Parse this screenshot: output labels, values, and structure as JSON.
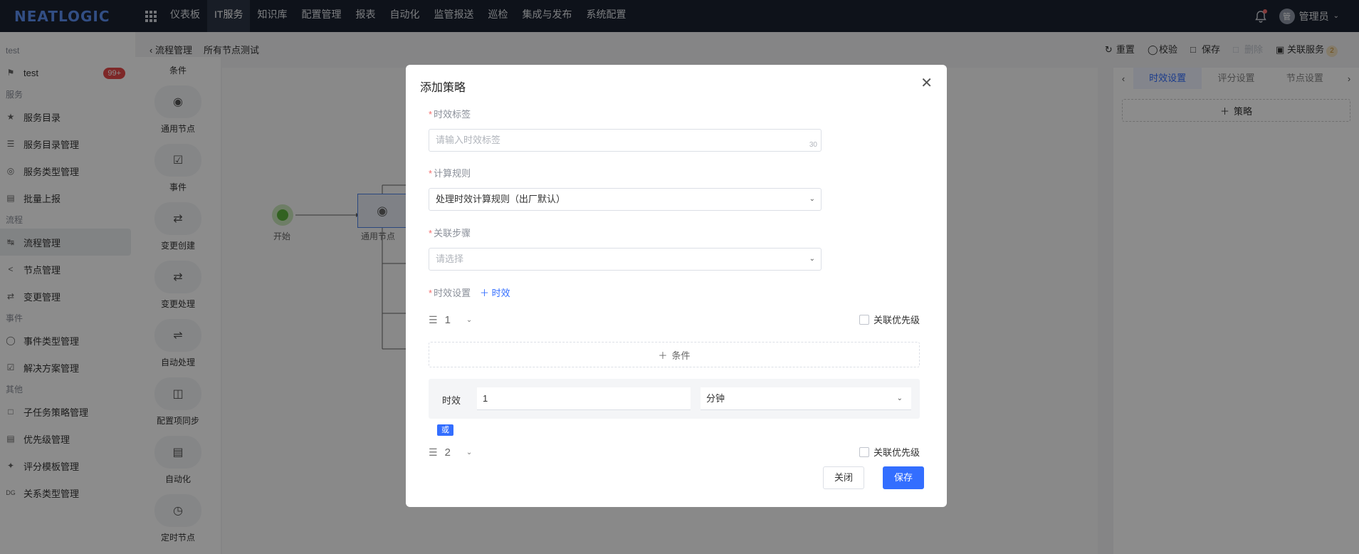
{
  "topbar": {
    "logo": "NEATLOGIC",
    "nav": [
      "仪表板",
      "IT服务",
      "知识库",
      "配置管理",
      "报表",
      "自动化",
      "监管报送",
      "巡检",
      "集成与发布",
      "系统配置"
    ],
    "active_nav_index": 1,
    "user_avatar": "管",
    "user_name": "管理员"
  },
  "sidebar": {
    "group_test": "test",
    "item_test": "test",
    "item_test_badge": "99+",
    "group_service": "服务",
    "service_items": [
      "服务目录",
      "服务目录管理",
      "服务类型管理",
      "批量上报"
    ],
    "group_process": "流程",
    "process_items": [
      "流程管理",
      "节点管理",
      "变更管理"
    ],
    "group_event": "事件",
    "event_items": [
      "事件类型管理",
      "解决方案管理"
    ],
    "group_other": "其他",
    "other_items": [
      "子任务策略管理",
      "优先级管理",
      "评分模板管理",
      "关系类型管理"
    ]
  },
  "header": {
    "back_label": "流程管理",
    "title": "所有节点测试",
    "reset": "重置",
    "validate": "校验",
    "save": "保存",
    "delete": "删除",
    "related_service": "关联服务",
    "related_count": "2"
  },
  "palette": {
    "title": "条件",
    "items": [
      "通用节点",
      "事件",
      "变更创建",
      "变更处理",
      "自动处理",
      "配置项同步",
      "自动化",
      "定时节点"
    ]
  },
  "canvas": {
    "start_label": "开始",
    "node_label": "通用节点"
  },
  "rightpanel": {
    "tabs": [
      "时效设置",
      "评分设置",
      "节点设置"
    ],
    "add_policy": "策略"
  },
  "modal": {
    "title": "添加策略",
    "label_tag": "时效标签",
    "tag_placeholder": "请输入时效标签",
    "tag_maxlen": "30",
    "label_rule": "计算规则",
    "rule_value": "处理时效计算规则（出厂默认）",
    "label_step": "关联步骤",
    "step_placeholder": "请选择",
    "label_setting": "时效设置",
    "add_timeliness": "时效",
    "rule1_index": "1",
    "priority_label": "关联优先级",
    "add_condition": "条件",
    "time_label": "时效",
    "time_value": "1",
    "time_unit": "分钟",
    "or_tag": "或",
    "rule2_index": "2",
    "btn_close": "关闭",
    "btn_save": "保存"
  }
}
